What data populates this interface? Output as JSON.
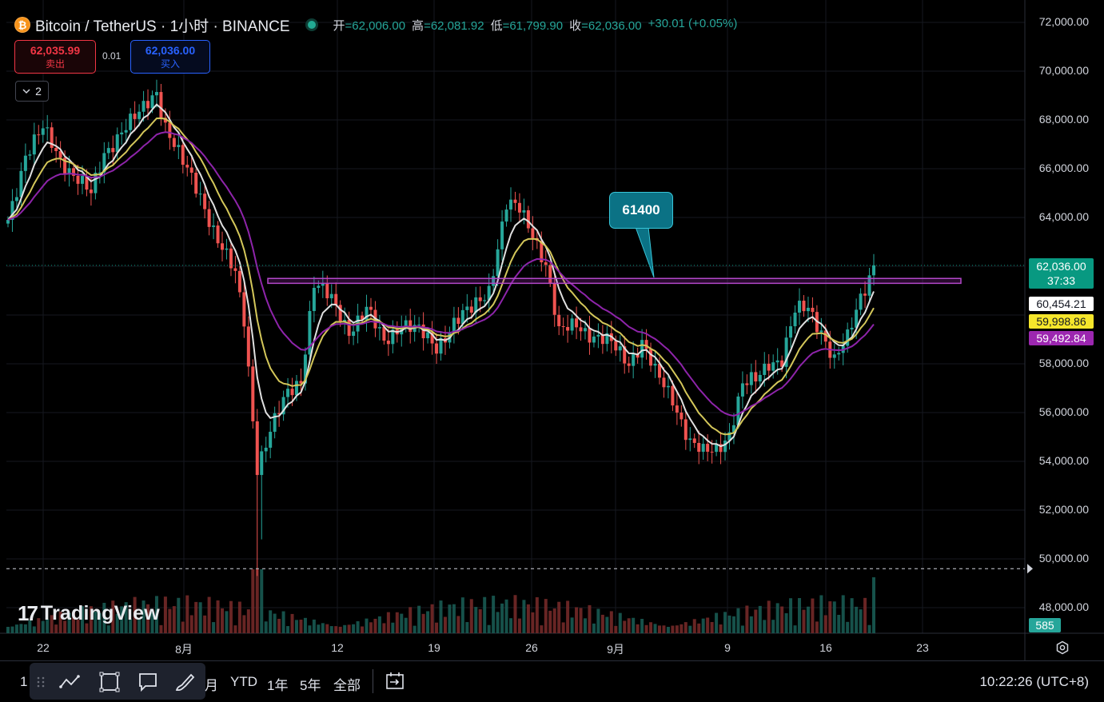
{
  "header": {
    "symbol": "Bitcoin / TetherUS · 1小时 · BINANCE",
    "ohlc": {
      "open_key": "开",
      "open": "=62,006.00",
      "high_key": "高",
      "high": "=62,081.92",
      "low_key": "低",
      "low": "=61,799.90",
      "close_key": "收",
      "close": "=62,036.00",
      "change": "+30.01 (+0.05%)"
    }
  },
  "trade": {
    "sell_price": "62,035.99",
    "sell_label": "卖出",
    "spread": "0.01",
    "buy_price": "62,036.00",
    "buy_label": "买入"
  },
  "indicators": {
    "toggle_count": "2"
  },
  "callout": {
    "text": "61400",
    "price": 61400
  },
  "price_axis": {
    "labels": [
      "72,000.00",
      "70,000.00",
      "68,000.00",
      "66,000.00",
      "64,000.00",
      "58,000.00",
      "56,000.00",
      "54,000.00",
      "52,000.00",
      "50,000.00",
      "48,000.00"
    ],
    "current_price": "62,036.00",
    "countdown": "37:33",
    "ma_white": "60,454.21",
    "ma_yellow": "59,998.86",
    "ma_purple": "59,492.84",
    "volume": "585"
  },
  "time_axis": {
    "labels": [
      "22",
      "8月",
      "12",
      "19",
      "26",
      "9月",
      "9",
      "16",
      "23"
    ]
  },
  "watermark": {
    "text": "TradingView"
  },
  "bottom_bar": {
    "ranges": [
      "1",
      "月",
      "YTD",
      "1年",
      "5年",
      "全部"
    ],
    "clock": "10:22:26 (UTC+8)"
  },
  "colors": {
    "up": "#26a69a",
    "down": "#ef5350",
    "ma_white": "#e0e0e0",
    "ma_yellow": "#d4c75a",
    "ma_purple": "#8e24aa",
    "callout": "#0b7285"
  },
  "chart_data": {
    "type": "candlestick",
    "y_range": [
      47000,
      72500
    ],
    "key_prices": [
      {
        "t": 0,
        "p": 63900
      },
      {
        "t": 4,
        "p": 66600
      },
      {
        "t": 8,
        "p": 67600
      },
      {
        "t": 12,
        "p": 66400
      },
      {
        "t": 16,
        "p": 65600
      },
      {
        "t": 19,
        "p": 64900
      },
      {
        "t": 22,
        "p": 66600
      },
      {
        "t": 26,
        "p": 67600
      },
      {
        "t": 30,
        "p": 68200
      },
      {
        "t": 34,
        "p": 69200
      },
      {
        "t": 36,
        "p": 67800
      },
      {
        "t": 40,
        "p": 66200
      },
      {
        "t": 44,
        "p": 64900
      },
      {
        "t": 48,
        "p": 63100
      },
      {
        "t": 52,
        "p": 61600
      },
      {
        "t": 54,
        "p": 59800
      },
      {
        "t": 57,
        "p": 53800
      },
      {
        "t": 60,
        "p": 55200
      },
      {
        "t": 64,
        "p": 56800
      },
      {
        "t": 67,
        "p": 57400
      },
      {
        "t": 70,
        "p": 61300
      },
      {
        "t": 74,
        "p": 60600
      },
      {
        "t": 78,
        "p": 59400
      },
      {
        "t": 82,
        "p": 60200
      },
      {
        "t": 86,
        "p": 58900
      },
      {
        "t": 90,
        "p": 59700
      },
      {
        "t": 94,
        "p": 59300
      },
      {
        "t": 98,
        "p": 58700
      },
      {
        "t": 102,
        "p": 59700
      },
      {
        "t": 106,
        "p": 60200
      },
      {
        "t": 110,
        "p": 61100
      },
      {
        "t": 114,
        "p": 64500
      },
      {
        "t": 117,
        "p": 64300
      },
      {
        "t": 120,
        "p": 63400
      },
      {
        "t": 123,
        "p": 62100
      },
      {
        "t": 126,
        "p": 59200
      },
      {
        "t": 130,
        "p": 59700
      },
      {
        "t": 134,
        "p": 59100
      },
      {
        "t": 138,
        "p": 58800
      },
      {
        "t": 142,
        "p": 58100
      },
      {
        "t": 145,
        "p": 58900
      },
      {
        "t": 148,
        "p": 57600
      },
      {
        "t": 152,
        "p": 56600
      },
      {
        "t": 156,
        "p": 54800
      },
      {
        "t": 159,
        "p": 54300
      },
      {
        "t": 162,
        "p": 54500
      },
      {
        "t": 165,
        "p": 55200
      },
      {
        "t": 168,
        "p": 57100
      },
      {
        "t": 171,
        "p": 57300
      },
      {
        "t": 174,
        "p": 58100
      },
      {
        "t": 177,
        "p": 58200
      },
      {
        "t": 180,
        "p": 60100
      },
      {
        "t": 183,
        "p": 60300
      },
      {
        "t": 186,
        "p": 59400
      },
      {
        "t": 189,
        "p": 58100
      },
      {
        "t": 192,
        "p": 59000
      },
      {
        "t": 195,
        "p": 60800
      },
      {
        "t": 198,
        "p": 62036
      }
    ],
    "resistance_zone": [
      61300,
      61500
    ],
    "ma_values": {
      "white": 60454.21,
      "yellow": 59998.86,
      "purple": 59492.84
    },
    "last_price": 62036.0,
    "dashed_level": 49600
  }
}
